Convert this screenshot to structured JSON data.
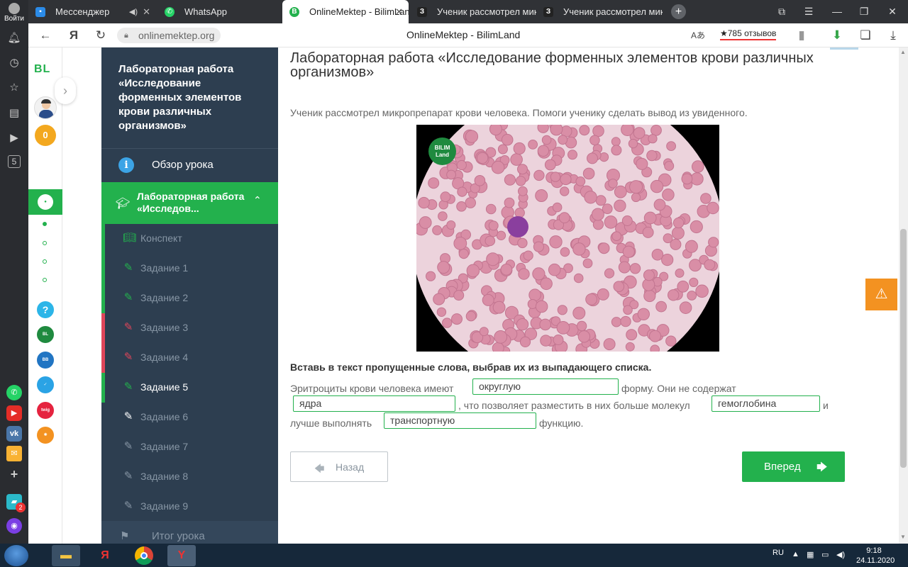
{
  "browser": {
    "tabs": [
      {
        "label": "Мессенджер"
      },
      {
        "label": "WhatsApp"
      },
      {
        "label": "OnlineMektep - BilimLand"
      },
      {
        "label": "Ученик рассмотрел микр"
      },
      {
        "label": "Ученик рассмотрел микр"
      }
    ],
    "url": "onlinemektep.org",
    "page_title": "OnlineMektep - BilimLand",
    "reviews": "★785 отзывов",
    "login_label": "Войти"
  },
  "rail": {
    "logo": "BL",
    "coins": "0",
    "sidebar_badge": "5"
  },
  "lesson_nav": {
    "title": "Лабораторная работа «Исследование форменных элементов крови различных организмов»",
    "overview": "Обзор урока",
    "section": "Лабораторная работа «Исследов...",
    "items": [
      {
        "label": "Конспект",
        "status_color": "#23b14d"
      },
      {
        "label": "Задание 1",
        "status_color": "#23b14d"
      },
      {
        "label": "Задание 2",
        "status_color": "#23b14d"
      },
      {
        "label": "Задание 3",
        "status_color": "#e0455a"
      },
      {
        "label": "Задание 4",
        "status_color": "#e0455a"
      },
      {
        "label": "Задание 5",
        "status_color": "#23b14d"
      },
      {
        "label": "Задание 6",
        "status_color": "#2d3e50"
      },
      {
        "label": "Задание 7",
        "status_color": "#2d3e50"
      },
      {
        "label": "Задание 8",
        "status_color": "#2d3e50"
      },
      {
        "label": "Задание 9",
        "status_color": "#2d3e50"
      }
    ],
    "final": "Итог урока"
  },
  "main": {
    "title": "Лабораторная работа «Исследование форменных элементов крови различных организмов»",
    "instruction": "Ученик рассмотрел микропрепарат крови человека. Помоги ученику сделать вывод из увиденного.",
    "image_logo": "BILIM Land",
    "task_heading": "Вставь в текст пропущенные слова, выбрав их из выпадающего списка.",
    "sentence": {
      "part1": "Эритроциты крови человека имеют",
      "blank1": "округлую",
      "part2": "форму. Они не содержат",
      "blank2": "ядра",
      "part3": ", что позволяет разместить в них больше молекул",
      "blank3": "гемоглобина",
      "part4": "и",
      "part5": "лучше выполнять",
      "blank4": "транспортную",
      "part6": "функцию."
    },
    "back_button": "Назад",
    "next_button": "Вперед"
  },
  "taskbar": {
    "language": "RU",
    "time": "9:18",
    "date": "24.11.2020"
  },
  "colors": {
    "accent": "#23b14d",
    "nav_bg": "#2d3e50",
    "error": "#e0455a",
    "warning": "#f39221"
  }
}
